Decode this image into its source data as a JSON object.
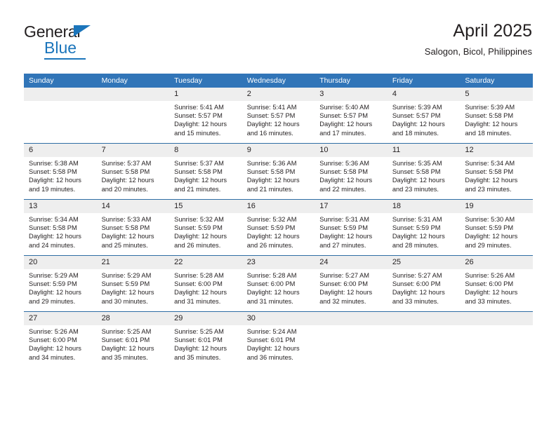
{
  "brand": {
    "line1": "General",
    "line2": "Blue",
    "triangle_icon": "blue-triangle-logo-mark",
    "accent_color": "#1b75bb"
  },
  "header": {
    "title": "April 2025",
    "subtitle": "Salogon, Bicol, Philippines"
  },
  "theme": {
    "header_blue": "#3175b8",
    "row_divider_blue": "#2e6da4",
    "daynum_band": "#eeeeee"
  },
  "weekday_headers": [
    "Sunday",
    "Monday",
    "Tuesday",
    "Wednesday",
    "Thursday",
    "Friday",
    "Saturday"
  ],
  "weeks": [
    [
      {
        "day": "",
        "empty": true,
        "sunrise": "",
        "sunset": "",
        "daylight1": "",
        "daylight2": ""
      },
      {
        "day": "",
        "empty": true,
        "sunrise": "",
        "sunset": "",
        "daylight1": "",
        "daylight2": ""
      },
      {
        "day": "1",
        "sunrise": "Sunrise: 5:41 AM",
        "sunset": "Sunset: 5:57 PM",
        "daylight1": "Daylight: 12 hours",
        "daylight2": "and 15 minutes."
      },
      {
        "day": "2",
        "sunrise": "Sunrise: 5:41 AM",
        "sunset": "Sunset: 5:57 PM",
        "daylight1": "Daylight: 12 hours",
        "daylight2": "and 16 minutes."
      },
      {
        "day": "3",
        "sunrise": "Sunrise: 5:40 AM",
        "sunset": "Sunset: 5:57 PM",
        "daylight1": "Daylight: 12 hours",
        "daylight2": "and 17 minutes."
      },
      {
        "day": "4",
        "sunrise": "Sunrise: 5:39 AM",
        "sunset": "Sunset: 5:57 PM",
        "daylight1": "Daylight: 12 hours",
        "daylight2": "and 18 minutes."
      },
      {
        "day": "5",
        "sunrise": "Sunrise: 5:39 AM",
        "sunset": "Sunset: 5:58 PM",
        "daylight1": "Daylight: 12 hours",
        "daylight2": "and 18 minutes."
      }
    ],
    [
      {
        "day": "6",
        "sunrise": "Sunrise: 5:38 AM",
        "sunset": "Sunset: 5:58 PM",
        "daylight1": "Daylight: 12 hours",
        "daylight2": "and 19 minutes."
      },
      {
        "day": "7",
        "sunrise": "Sunrise: 5:37 AM",
        "sunset": "Sunset: 5:58 PM",
        "daylight1": "Daylight: 12 hours",
        "daylight2": "and 20 minutes."
      },
      {
        "day": "8",
        "sunrise": "Sunrise: 5:37 AM",
        "sunset": "Sunset: 5:58 PM",
        "daylight1": "Daylight: 12 hours",
        "daylight2": "and 21 minutes."
      },
      {
        "day": "9",
        "sunrise": "Sunrise: 5:36 AM",
        "sunset": "Sunset: 5:58 PM",
        "daylight1": "Daylight: 12 hours",
        "daylight2": "and 21 minutes."
      },
      {
        "day": "10",
        "sunrise": "Sunrise: 5:36 AM",
        "sunset": "Sunset: 5:58 PM",
        "daylight1": "Daylight: 12 hours",
        "daylight2": "and 22 minutes."
      },
      {
        "day": "11",
        "sunrise": "Sunrise: 5:35 AM",
        "sunset": "Sunset: 5:58 PM",
        "daylight1": "Daylight: 12 hours",
        "daylight2": "and 23 minutes."
      },
      {
        "day": "12",
        "sunrise": "Sunrise: 5:34 AM",
        "sunset": "Sunset: 5:58 PM",
        "daylight1": "Daylight: 12 hours",
        "daylight2": "and 23 minutes."
      }
    ],
    [
      {
        "day": "13",
        "sunrise": "Sunrise: 5:34 AM",
        "sunset": "Sunset: 5:58 PM",
        "daylight1": "Daylight: 12 hours",
        "daylight2": "and 24 minutes."
      },
      {
        "day": "14",
        "sunrise": "Sunrise: 5:33 AM",
        "sunset": "Sunset: 5:58 PM",
        "daylight1": "Daylight: 12 hours",
        "daylight2": "and 25 minutes."
      },
      {
        "day": "15",
        "sunrise": "Sunrise: 5:32 AM",
        "sunset": "Sunset: 5:59 PM",
        "daylight1": "Daylight: 12 hours",
        "daylight2": "and 26 minutes."
      },
      {
        "day": "16",
        "sunrise": "Sunrise: 5:32 AM",
        "sunset": "Sunset: 5:59 PM",
        "daylight1": "Daylight: 12 hours",
        "daylight2": "and 26 minutes."
      },
      {
        "day": "17",
        "sunrise": "Sunrise: 5:31 AM",
        "sunset": "Sunset: 5:59 PM",
        "daylight1": "Daylight: 12 hours",
        "daylight2": "and 27 minutes."
      },
      {
        "day": "18",
        "sunrise": "Sunrise: 5:31 AM",
        "sunset": "Sunset: 5:59 PM",
        "daylight1": "Daylight: 12 hours",
        "daylight2": "and 28 minutes."
      },
      {
        "day": "19",
        "sunrise": "Sunrise: 5:30 AM",
        "sunset": "Sunset: 5:59 PM",
        "daylight1": "Daylight: 12 hours",
        "daylight2": "and 29 minutes."
      }
    ],
    [
      {
        "day": "20",
        "sunrise": "Sunrise: 5:29 AM",
        "sunset": "Sunset: 5:59 PM",
        "daylight1": "Daylight: 12 hours",
        "daylight2": "and 29 minutes."
      },
      {
        "day": "21",
        "sunrise": "Sunrise: 5:29 AM",
        "sunset": "Sunset: 5:59 PM",
        "daylight1": "Daylight: 12 hours",
        "daylight2": "and 30 minutes."
      },
      {
        "day": "22",
        "sunrise": "Sunrise: 5:28 AM",
        "sunset": "Sunset: 6:00 PM",
        "daylight1": "Daylight: 12 hours",
        "daylight2": "and 31 minutes."
      },
      {
        "day": "23",
        "sunrise": "Sunrise: 5:28 AM",
        "sunset": "Sunset: 6:00 PM",
        "daylight1": "Daylight: 12 hours",
        "daylight2": "and 31 minutes."
      },
      {
        "day": "24",
        "sunrise": "Sunrise: 5:27 AM",
        "sunset": "Sunset: 6:00 PM",
        "daylight1": "Daylight: 12 hours",
        "daylight2": "and 32 minutes."
      },
      {
        "day": "25",
        "sunrise": "Sunrise: 5:27 AM",
        "sunset": "Sunset: 6:00 PM",
        "daylight1": "Daylight: 12 hours",
        "daylight2": "and 33 minutes."
      },
      {
        "day": "26",
        "sunrise": "Sunrise: 5:26 AM",
        "sunset": "Sunset: 6:00 PM",
        "daylight1": "Daylight: 12 hours",
        "daylight2": "and 33 minutes."
      }
    ],
    [
      {
        "day": "27",
        "sunrise": "Sunrise: 5:26 AM",
        "sunset": "Sunset: 6:00 PM",
        "daylight1": "Daylight: 12 hours",
        "daylight2": "and 34 minutes."
      },
      {
        "day": "28",
        "sunrise": "Sunrise: 5:25 AM",
        "sunset": "Sunset: 6:01 PM",
        "daylight1": "Daylight: 12 hours",
        "daylight2": "and 35 minutes."
      },
      {
        "day": "29",
        "sunrise": "Sunrise: 5:25 AM",
        "sunset": "Sunset: 6:01 PM",
        "daylight1": "Daylight: 12 hours",
        "daylight2": "and 35 minutes."
      },
      {
        "day": "30",
        "sunrise": "Sunrise: 5:24 AM",
        "sunset": "Sunset: 6:01 PM",
        "daylight1": "Daylight: 12 hours",
        "daylight2": "and 36 minutes."
      },
      {
        "day": "",
        "empty": true,
        "sunrise": "",
        "sunset": "",
        "daylight1": "",
        "daylight2": ""
      },
      {
        "day": "",
        "empty": true,
        "sunrise": "",
        "sunset": "",
        "daylight1": "",
        "daylight2": ""
      },
      {
        "day": "",
        "empty": true,
        "sunrise": "",
        "sunset": "",
        "daylight1": "",
        "daylight2": ""
      }
    ]
  ]
}
